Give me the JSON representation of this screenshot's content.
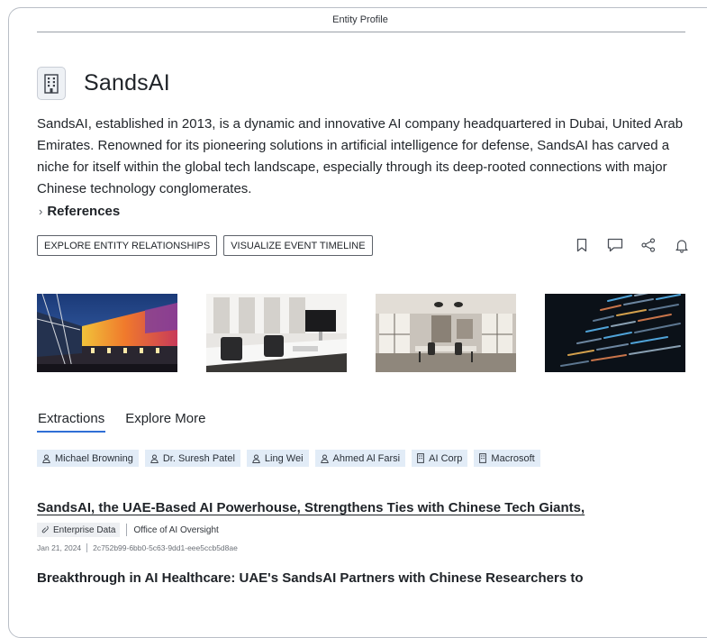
{
  "page": {
    "title": "Entity Profile"
  },
  "entity": {
    "name": "SandsAI",
    "icon": "building-icon",
    "description": "SandsAI, established in 2013, is a dynamic and innovative AI company headquartered in Dubai, United Arab Emirates. Renowned for its pioneering solutions in artificial intelligence for defense, SandsAI has carved a niche for itself within the global tech landscape, especially through its deep-rooted connections with major Chinese technology conglomerates."
  },
  "references": {
    "label": "References"
  },
  "actions": {
    "explore_label": "EXPLORE ENTITY RELATIONSHIPS",
    "timeline_label": "VISUALIZE EVENT TIMELINE"
  },
  "toolbar_icons": [
    "bookmark-icon",
    "comment-icon",
    "share-icon",
    "bell-icon"
  ],
  "tabs": [
    {
      "label": "Extractions",
      "active": true
    },
    {
      "label": "Explore More",
      "active": false
    }
  ],
  "chips": [
    {
      "label": "Michael Browning",
      "icon": "person-icon"
    },
    {
      "label": "Dr. Suresh Patel",
      "icon": "person-icon"
    },
    {
      "label": "Ling Wei",
      "icon": "person-icon"
    },
    {
      "label": "Ahmed Al Farsi",
      "icon": "person-icon"
    },
    {
      "label": "AI Corp",
      "icon": "building-icon"
    },
    {
      "label": "Macrosoft",
      "icon": "building-icon"
    }
  ],
  "articles": [
    {
      "title": "SandsAI, the UAE-Based AI Powerhouse, Strengthens Ties with Chinese Tech Giants,",
      "tag": "Enterprise Data",
      "source": "Office of AI Oversight",
      "date": "Jan 21, 2024",
      "id": "2c752b99-6bb0-5c63-9dd1-eee5ccb5d8ae"
    },
    {
      "title": "Breakthrough in AI Healthcare: UAE's SandsAI Partners with Chinese Researchers to"
    }
  ],
  "colors": {
    "accent": "#2f6fd6",
    "chip_bg": "#e2ecf7",
    "tag_bg": "#edeff2"
  }
}
